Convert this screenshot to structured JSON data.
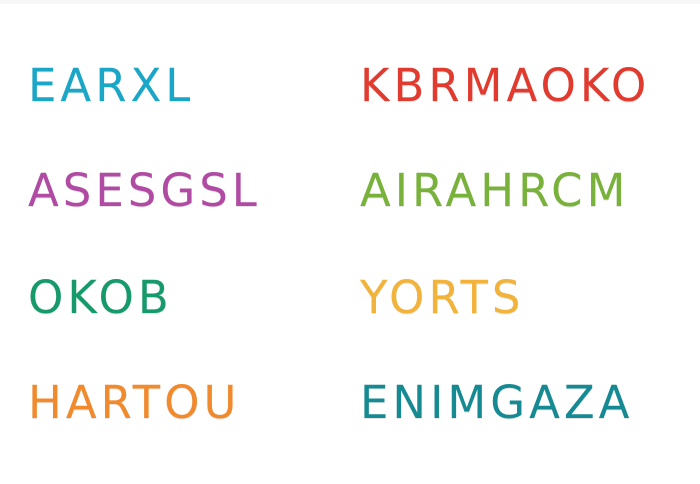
{
  "words": [
    {
      "text": "EARXL",
      "color": "#1aa6c7"
    },
    {
      "text": "KBRMAOKO",
      "color": "#e13b2f"
    },
    {
      "text": "ASESGSL",
      "color": "#b04aa3"
    },
    {
      "text": "AIRAHRCM",
      "color": "#78b23b"
    },
    {
      "text": "OKOB",
      "color": "#16996b"
    },
    {
      "text": "YORTS",
      "color": "#f2b33b"
    },
    {
      "text": "HARTOU",
      "color": "#f08a2c"
    },
    {
      "text": "ENIMGAZA",
      "color": "#168a92"
    }
  ]
}
